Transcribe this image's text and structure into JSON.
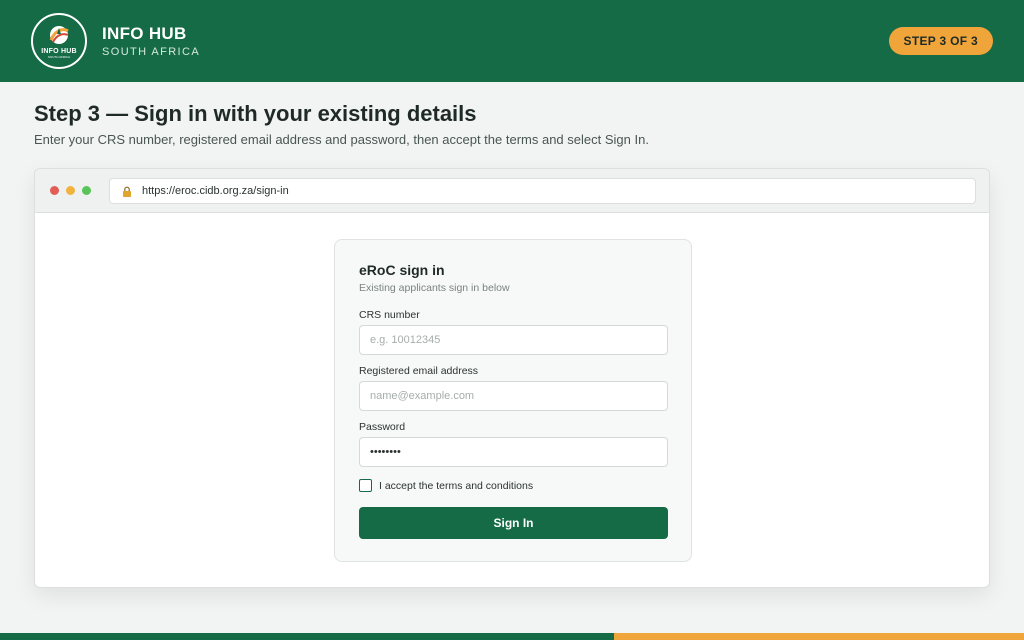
{
  "header": {
    "logo": {
      "text": "INFO HUB",
      "subtext": "SOUTH AFRICA"
    },
    "brand_title": "INFO HUB",
    "brand_subtitle": "SOUTH AFRICA",
    "step_badge": "STEP 3 OF 3"
  },
  "page": {
    "heading": "Step 3 — Sign in with your existing details",
    "subheading": "Enter your CRS number, registered email address and password, then accept the terms and select Sign In."
  },
  "browser": {
    "url": "https://eroc.cidb.org.za/sign-in",
    "icons": {
      "lock": "lock-icon"
    }
  },
  "signin_form": {
    "title": "eRoC sign in",
    "subtitle": "Existing applicants sign in below",
    "crs": {
      "label": "CRS number",
      "placeholder": "e.g. 10012345",
      "value": ""
    },
    "email": {
      "label": "Registered email address",
      "placeholder": "name@example.com",
      "value": ""
    },
    "password": {
      "label": "Password",
      "placeholder": "",
      "value": "••••••••"
    },
    "terms_label": "I accept the terms and conditions",
    "terms_checked": false,
    "submit_label": "Sign In"
  },
  "colors": {
    "brand_green": "#166b47",
    "accent_orange": "#f0a53a"
  }
}
